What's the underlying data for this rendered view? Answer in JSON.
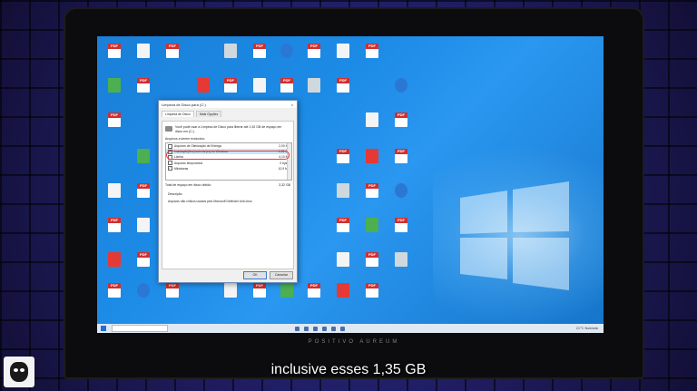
{
  "laptop": {
    "brand": "POSITIVO AUREUM"
  },
  "subtitle": "inclusive esses 1,35 GB",
  "colors": {
    "desktop_blue": "#1c8be6",
    "highlight_red": "#e53935",
    "dialog_bg": "#f0f0f0"
  },
  "dialog": {
    "title": "Limpeza de Disco para (C:)",
    "close_label": "×",
    "tabs": [
      "Limpeza de Disco",
      "Mais Opções"
    ],
    "intro": "Você pode usar a Limpeza de Disco para liberar até 1,52 GB de espaço em disco em (C:).",
    "files_label": "Arquivos a serem excluídos:",
    "files": [
      {
        "name": "Arquivos de Otimização de Entrega",
        "size": "2,00 KB",
        "checked": false
      },
      {
        "name": "Instalação(ões) anterior(es) do Windows",
        "size": "1,35 GB",
        "checked": true
      },
      {
        "name": "Lixeira",
        "size": "4,10 KB",
        "checked": false
      },
      {
        "name": "Arquivos temporários",
        "size": "0 bytes",
        "checked": false
      },
      {
        "name": "Miniaturas",
        "size": "10,9 MB",
        "checked": true
      }
    ],
    "total_label": "Total de espaço em disco obtido:",
    "total_value": "3,32 GB",
    "description_label": "Descrição",
    "description_text": "Arquivos não críticos usados pelo Microsoft Defender Anti-vírus",
    "ok_label": "OK",
    "cancel_label": "Cancelar"
  },
  "taskbar": {
    "clock": "21°C Nublado"
  }
}
